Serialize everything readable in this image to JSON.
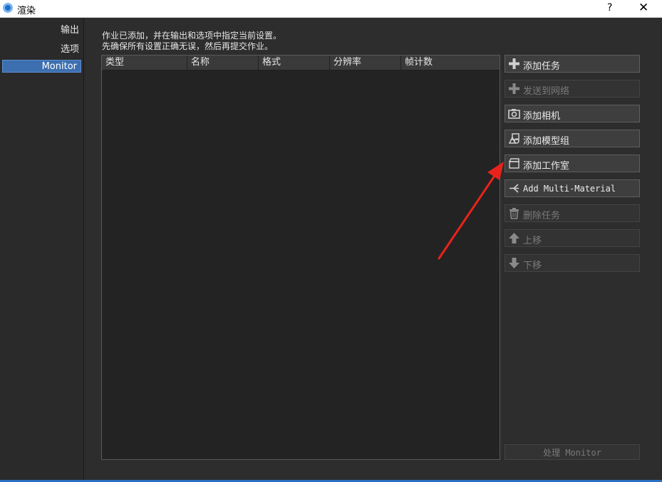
{
  "window": {
    "title": "渲染",
    "help_label": "?",
    "close_label": "✕",
    "icon": "render-app-icon"
  },
  "sidebar": {
    "items": [
      {
        "label": "输出",
        "selected": false
      },
      {
        "label": "选项",
        "selected": false
      },
      {
        "label": "Monitor",
        "selected": true
      }
    ]
  },
  "main": {
    "info_line1": "作业已添加，并在输出和选项中指定当前设置。",
    "info_line2": "先确保所有设置正确无误，然后再提交作业。",
    "table": {
      "columns": [
        "类型",
        "名称",
        "格式",
        "分辨率",
        "帧计数"
      ],
      "rows": []
    },
    "buttons": [
      {
        "label": "添加任务",
        "icon": "plus-icon",
        "enabled": true
      },
      {
        "label": "发送到网络",
        "icon": "plus-icon",
        "enabled": false
      },
      {
        "label": "添加相机",
        "icon": "camera-icon",
        "enabled": true
      },
      {
        "label": "添加模型组",
        "icon": "shapes-icon",
        "enabled": true
      },
      {
        "label": "添加工作室",
        "icon": "studio-icon",
        "enabled": true
      },
      {
        "label": "Add Multi-Material",
        "icon": "multi-material-icon",
        "enabled": true
      },
      {
        "label": "删除任务",
        "icon": "trash-icon",
        "enabled": false
      },
      {
        "label": "上移",
        "icon": "arrow-up-icon",
        "enabled": false
      },
      {
        "label": "下移",
        "icon": "arrow-down-icon",
        "enabled": false
      }
    ],
    "process_button": {
      "label": "处理 Monitor",
      "enabled": false
    }
  },
  "colors": {
    "accent": "#3d6fb0",
    "annotation_arrow": "#e8231c"
  }
}
